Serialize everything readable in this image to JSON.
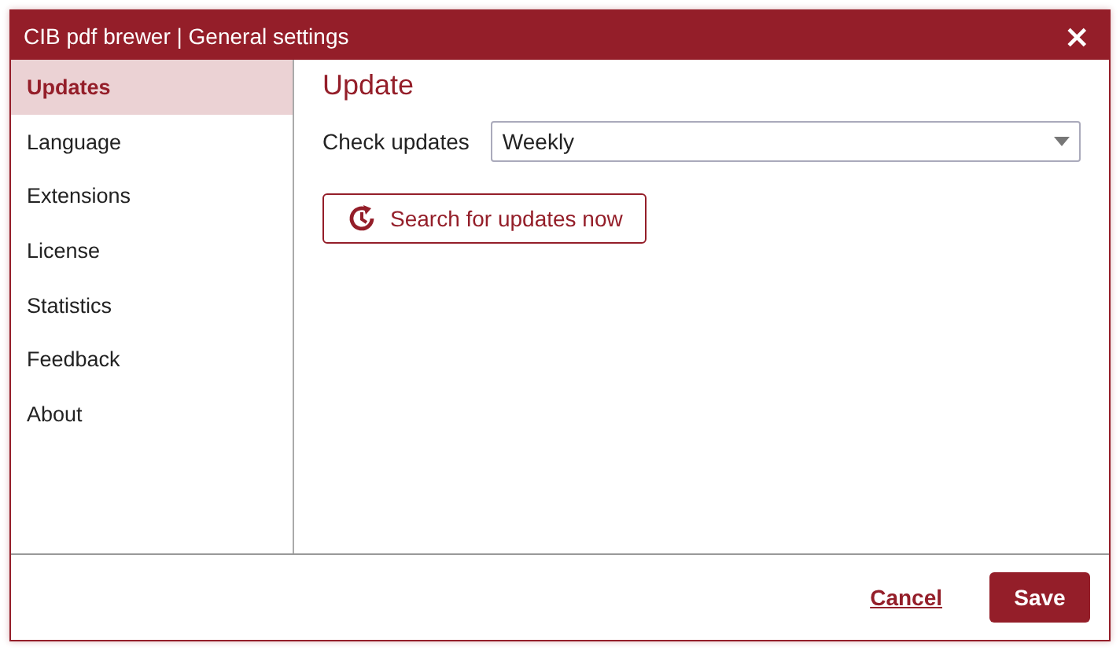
{
  "window": {
    "title": "CIB pdf brewer | General settings",
    "close": "×"
  },
  "sidebar": {
    "items": [
      {
        "label": "Updates",
        "selected": true
      },
      {
        "label": "Language",
        "selected": false
      },
      {
        "label": "Extensions",
        "selected": false
      },
      {
        "label": "License",
        "selected": false
      },
      {
        "label": "Statistics",
        "selected": false
      },
      {
        "label": "Feedback",
        "selected": false
      },
      {
        "label": "About",
        "selected": false
      }
    ]
  },
  "content": {
    "heading": "Update",
    "check_updates": {
      "label": "Check updates",
      "value": "Weekly"
    },
    "search_button": "Search for updates now"
  },
  "footer": {
    "cancel": "Cancel",
    "save": "Save"
  }
}
